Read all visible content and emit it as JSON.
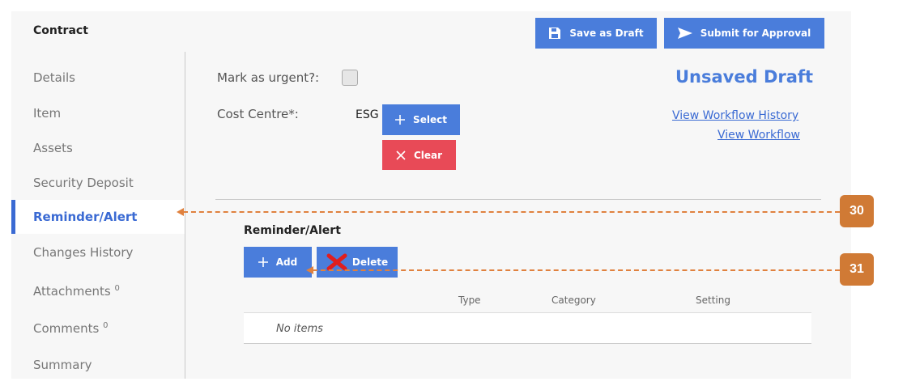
{
  "header": {
    "title": "Contract",
    "save_draft_label": "Save as Draft",
    "submit_label": "Submit for Approval"
  },
  "sidebar": {
    "items": [
      {
        "label": "Details"
      },
      {
        "label": "Item"
      },
      {
        "label": "Assets"
      },
      {
        "label": "Security Deposit"
      },
      {
        "label": "Reminder/Alert",
        "active": true
      },
      {
        "label": "Changes History"
      },
      {
        "label": "Attachments",
        "count": "0"
      },
      {
        "label": "Comments",
        "count": "0"
      },
      {
        "label": "Summary"
      }
    ]
  },
  "form": {
    "urgent_label": "Mark as urgent?:",
    "urgent_checked": false,
    "cost_centre_label": "Cost Centre*:",
    "cost_centre_value": "ESG",
    "select_label": "Select",
    "clear_label": "Clear"
  },
  "status": {
    "draft_status": "Unsaved Draft",
    "view_history_link": "View Workflow History",
    "view_workflow_link": "View Workflow"
  },
  "reminder": {
    "section_title": "Reminder/Alert",
    "add_label": "Add",
    "delete_label": "Delete",
    "columns": [
      "Type",
      "Category",
      "Setting"
    ],
    "empty_text": "No items"
  },
  "callouts": [
    {
      "number": "30"
    },
    {
      "number": "31"
    }
  ],
  "colors": {
    "primary": "#4a7ddb",
    "danger": "#e84a57",
    "callout": "#d07a35"
  }
}
